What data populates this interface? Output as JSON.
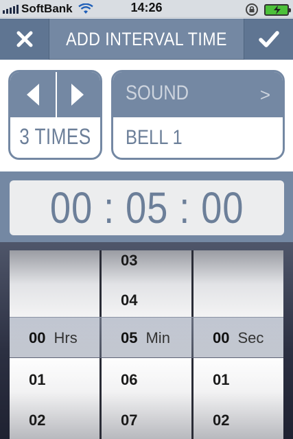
{
  "status_bar": {
    "carrier": "SoftBank",
    "time": "14:26"
  },
  "header": {
    "title": "ADD INTERVAL TIME",
    "cancel_icon": "close-icon",
    "confirm_icon": "checkmark-icon"
  },
  "repeat": {
    "value": "3 TIMES"
  },
  "sound": {
    "label": "SOUND",
    "arrow": ">",
    "value": "BELL 1"
  },
  "time_display": "00 : 05 : 00",
  "picker": {
    "hours": {
      "above": [
        "",
        ""
      ],
      "selected": "00",
      "unit": "Hrs",
      "below": [
        "01",
        "02"
      ]
    },
    "minutes": {
      "above": [
        "03",
        "04"
      ],
      "selected": "05",
      "unit": "Min",
      "below": [
        "06",
        "07"
      ]
    },
    "seconds": {
      "above": [
        "",
        ""
      ],
      "selected": "00",
      "unit": "Sec",
      "below": [
        "01",
        "02"
      ]
    }
  },
  "colors": {
    "accent": "#7488a3",
    "accent_dark": "#5f7592",
    "text_value": "#6c7f99",
    "battery": "#4cc03a"
  }
}
